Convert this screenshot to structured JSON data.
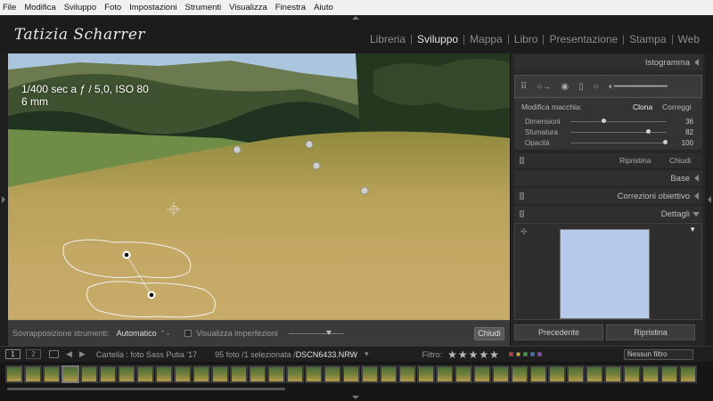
{
  "menu": [
    "File",
    "Modifica",
    "Sviluppo",
    "Foto",
    "Impostazioni",
    "Strumenti",
    "Visualizza",
    "Finestra",
    "Aiuto"
  ],
  "identity_plate": "Tatizia Scharrer",
  "modules": [
    {
      "label": "Libreria",
      "active": false
    },
    {
      "label": "Sviluppo",
      "active": true
    },
    {
      "label": "Mappa",
      "active": false
    },
    {
      "label": "Libro",
      "active": false
    },
    {
      "label": "Presentazione",
      "active": false
    },
    {
      "label": "Stampa",
      "active": false
    },
    {
      "label": "Web",
      "active": false
    }
  ],
  "exif": {
    "line1": "1/400 sec a ƒ / 5,0, ISO 80",
    "line2": "6 mm"
  },
  "toolbar": {
    "overlay_label": "Sovrapposizione strumenti:",
    "overlay_value": "Automatico",
    "visualize_label": "Visualizza imperfezioni",
    "close_label": "Chiudi"
  },
  "right_panel": {
    "histogram": "Istogramma",
    "spot": {
      "mode_label": "Modifica macchia:",
      "clone": "Clona",
      "heal": "Correggi",
      "sliders": [
        {
          "label": "Dimensioni",
          "value": "36",
          "level": 0.34
        },
        {
          "label": "Sfumatura",
          "value": "82",
          "level": 0.82
        },
        {
          "label": "Opacità",
          "value": "100",
          "level": 1.0
        }
      ],
      "reset": "Ripristina",
      "close": "Chiudi"
    },
    "sections": [
      "Base",
      "Correzioni obiettivo",
      "Dettagli"
    ],
    "prev_button": "Precedente",
    "reset_button": "Ripristina"
  },
  "filmstrip": {
    "page1": "1",
    "page2": "2",
    "folder": "Cartella : foto Sass Putia '17",
    "count": "95 foto /1 selezionata /",
    "file": "DSCN6433.NRW",
    "filter_label": "Filtro:",
    "stars": "★★★★★",
    "filter_value": "Nessun filtro",
    "label_colors": [
      "#c23a3a",
      "#c9b23a",
      "#3ea34a",
      "#3a6fc2",
      "#8a4ac2"
    ]
  }
}
